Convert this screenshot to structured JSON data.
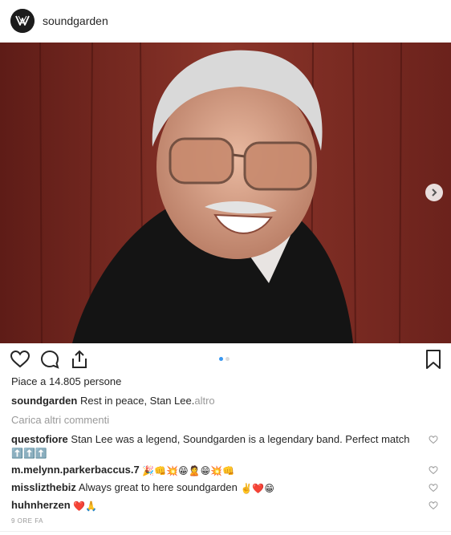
{
  "post": {
    "account": "soundgarden",
    "likes_text": "Piace a 14.805 persone",
    "caption_user": "soundgarden",
    "caption_text": "Rest in peace, Stan Lee.",
    "caption_more": "altro",
    "load_more": "Carica altri commenti",
    "timestamp": "9 ORE FA",
    "carousel": {
      "slides": 2,
      "current": 1
    }
  },
  "comments": [
    {
      "user": "questofiore",
      "text": "Stan Lee was a legend, Soundgarden is a legendary band. Perfect match",
      "emojis": "⬆️⬆️⬆️"
    },
    {
      "user": "m.melynn.parkerbaccus.7",
      "text": "",
      "emojis": "🎉👊💥😁🙎😁💥👊"
    },
    {
      "user": "misslizthebiz",
      "text": "Always great to here soundgarden",
      "emojis": "✌️❤️😁"
    },
    {
      "user": "huhnherzen",
      "text": "",
      "emojis": "❤️🙏"
    }
  ],
  "icons": {
    "avatar": "soundgarden-logo",
    "like": "heart-icon",
    "comment": "comment-icon",
    "share": "share-icon",
    "save": "bookmark-icon",
    "next": "chevron-right-icon",
    "comment_like": "heart-icon"
  },
  "colors": {
    "accent_dot": "#3897f0",
    "muted_text": "#999999",
    "text": "#262626"
  }
}
